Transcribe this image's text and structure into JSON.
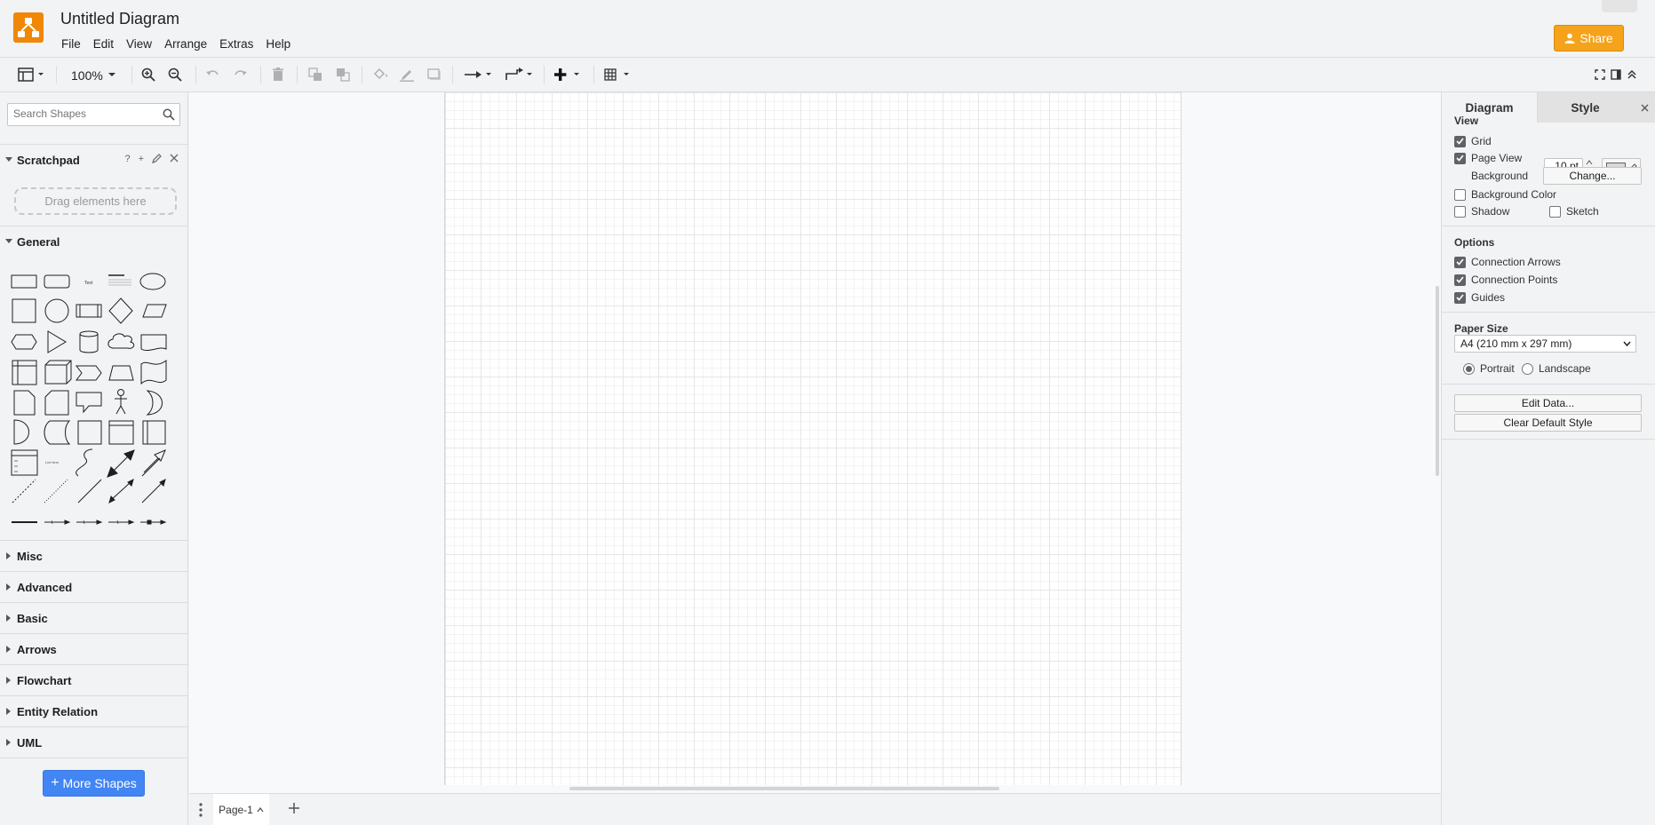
{
  "app": {
    "title": "Untitled Diagram"
  },
  "menu": [
    "File",
    "Edit",
    "View",
    "Arrange",
    "Extras",
    "Help"
  ],
  "share_label": "Share",
  "toolbar": {
    "zoom": "100%"
  },
  "sidebar": {
    "search_placeholder": "Search Shapes",
    "scratchpad": {
      "label": "Scratchpad",
      "drop_hint": "Drag elements here"
    },
    "general_label": "General",
    "libraries": [
      "Misc",
      "Advanced",
      "Basic",
      "Arrows",
      "Flowchart",
      "Entity Relation",
      "UML"
    ],
    "more_shapes_label": "More Shapes"
  },
  "pages": {
    "current": "Page-1"
  },
  "format_panel": {
    "tabs": [
      "Diagram",
      "Style"
    ],
    "view": {
      "title": "View",
      "grid_label": "Grid",
      "grid_checked": true,
      "grid_size": "10 pt",
      "page_view_label": "Page View",
      "page_view_checked": true,
      "background_label": "Background",
      "change_label": "Change...",
      "background_color_label": "Background Color",
      "background_color_checked": false,
      "shadow_label": "Shadow",
      "shadow_checked": false,
      "sketch_label": "Sketch",
      "sketch_checked": false
    },
    "options": {
      "title": "Options",
      "connection_arrows": "Connection Arrows",
      "connection_points": "Connection Points",
      "guides": "Guides"
    },
    "paper": {
      "title": "Paper Size",
      "size": "A4 (210 mm x 297 mm)",
      "portrait": "Portrait",
      "landscape": "Landscape",
      "orientation": "portrait"
    },
    "edit_data_label": "Edit Data...",
    "clear_style_label": "Clear Default Style"
  },
  "colors": {
    "share": "#f5a31b",
    "more_shapes": "#4285f4",
    "logo": "#f08705"
  }
}
